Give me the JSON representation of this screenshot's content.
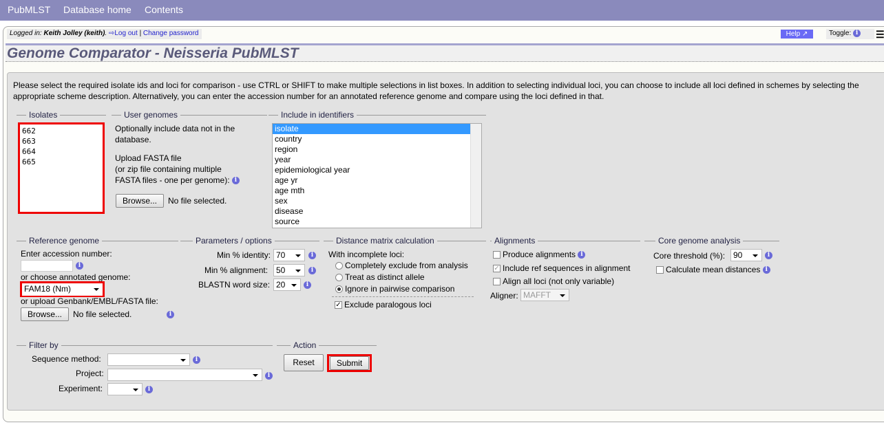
{
  "nav": {
    "items": [
      "PubMLST",
      "Database home",
      "Contents"
    ]
  },
  "login": {
    "prefix": "Logged in: ",
    "user": "Keith Jolley (keith)",
    "logout": "Log out",
    "sep": " | ",
    "change_password": "Change password"
  },
  "help": "Help ↗",
  "toggle": "Toggle: ",
  "title": "Genome Comparator - Neisseria PubMLST",
  "intro": "Please select the required isolate ids and loci for comparison - use CTRL or SHIFT to make multiple selections in list boxes. In addition to selecting individual loci, you can choose to include all loci defined in schemes by selecting the appropriate scheme description. Alternatively, you can enter the accession number for an annotated reference genome and compare using the loci defined in that.",
  "isolates": {
    "legend": "Isolates",
    "ids": "662\n663\n664\n665"
  },
  "user_genomes": {
    "legend": "User genomes",
    "text1": "Optionally include data not in the",
    "text2": "database.",
    "upload1": "Upload FASTA file",
    "upload2": "(or zip file containing multiple",
    "upload3": "FASTA files - one per genome):",
    "browse": "Browse...",
    "no_file": "No file selected."
  },
  "identifiers": {
    "legend": "Include in identifiers",
    "options": [
      "isolate",
      "country",
      "region",
      "year",
      "epidemiological year",
      "age yr",
      "age mth",
      "sex",
      "disease",
      "source"
    ],
    "selected": "isolate"
  },
  "reference": {
    "legend": "Reference genome",
    "accession_label": "Enter accession number:",
    "accession_value": "",
    "choose_label": "or choose annotated genome:",
    "genome": "FAM18 (Nm)",
    "upload_label": "or upload Genbank/EMBL/FASTA file:",
    "browse": "Browse...",
    "no_file": "No file selected."
  },
  "params": {
    "legend": "Parameters / options",
    "identity_label": "Min % identity:",
    "identity": "70",
    "alignment_label": "Min % alignment:",
    "alignment": "50",
    "word_label": "BLASTN word size:",
    "word": "20"
  },
  "distance": {
    "legend": "Distance matrix calculation",
    "incomplete_label": "With incomplete loci:",
    "options": [
      "Completely exclude from analysis",
      "Treat as distinct allele",
      "Ignore in pairwise comparison"
    ],
    "selected_index": 2,
    "paralogous": "Exclude paralogous loci",
    "paralogous_checked": true
  },
  "alignments": {
    "legend": "Alignments",
    "produce": "Produce alignments",
    "produce_checked": false,
    "include_ref": "Include ref sequences in alignment",
    "include_ref_checked": true,
    "align_all": "Align all loci (not only variable)",
    "align_all_checked": false,
    "aligner_label": "Aligner:",
    "aligner": "MAFFT"
  },
  "core": {
    "legend": "Core genome analysis",
    "threshold_label": "Core threshold (%):",
    "threshold": "90",
    "mean": "Calculate mean distances",
    "mean_checked": false
  },
  "filter": {
    "legend": "Filter by",
    "seq_method": "Sequence method:",
    "project": "Project:",
    "experiment": "Experiment:"
  },
  "action": {
    "legend": "Action",
    "reset": "Reset",
    "submit": "Submit"
  },
  "colors": {
    "nav": "#8a8abc",
    "highlight": "#ee0000",
    "help": "#6a6af5"
  }
}
